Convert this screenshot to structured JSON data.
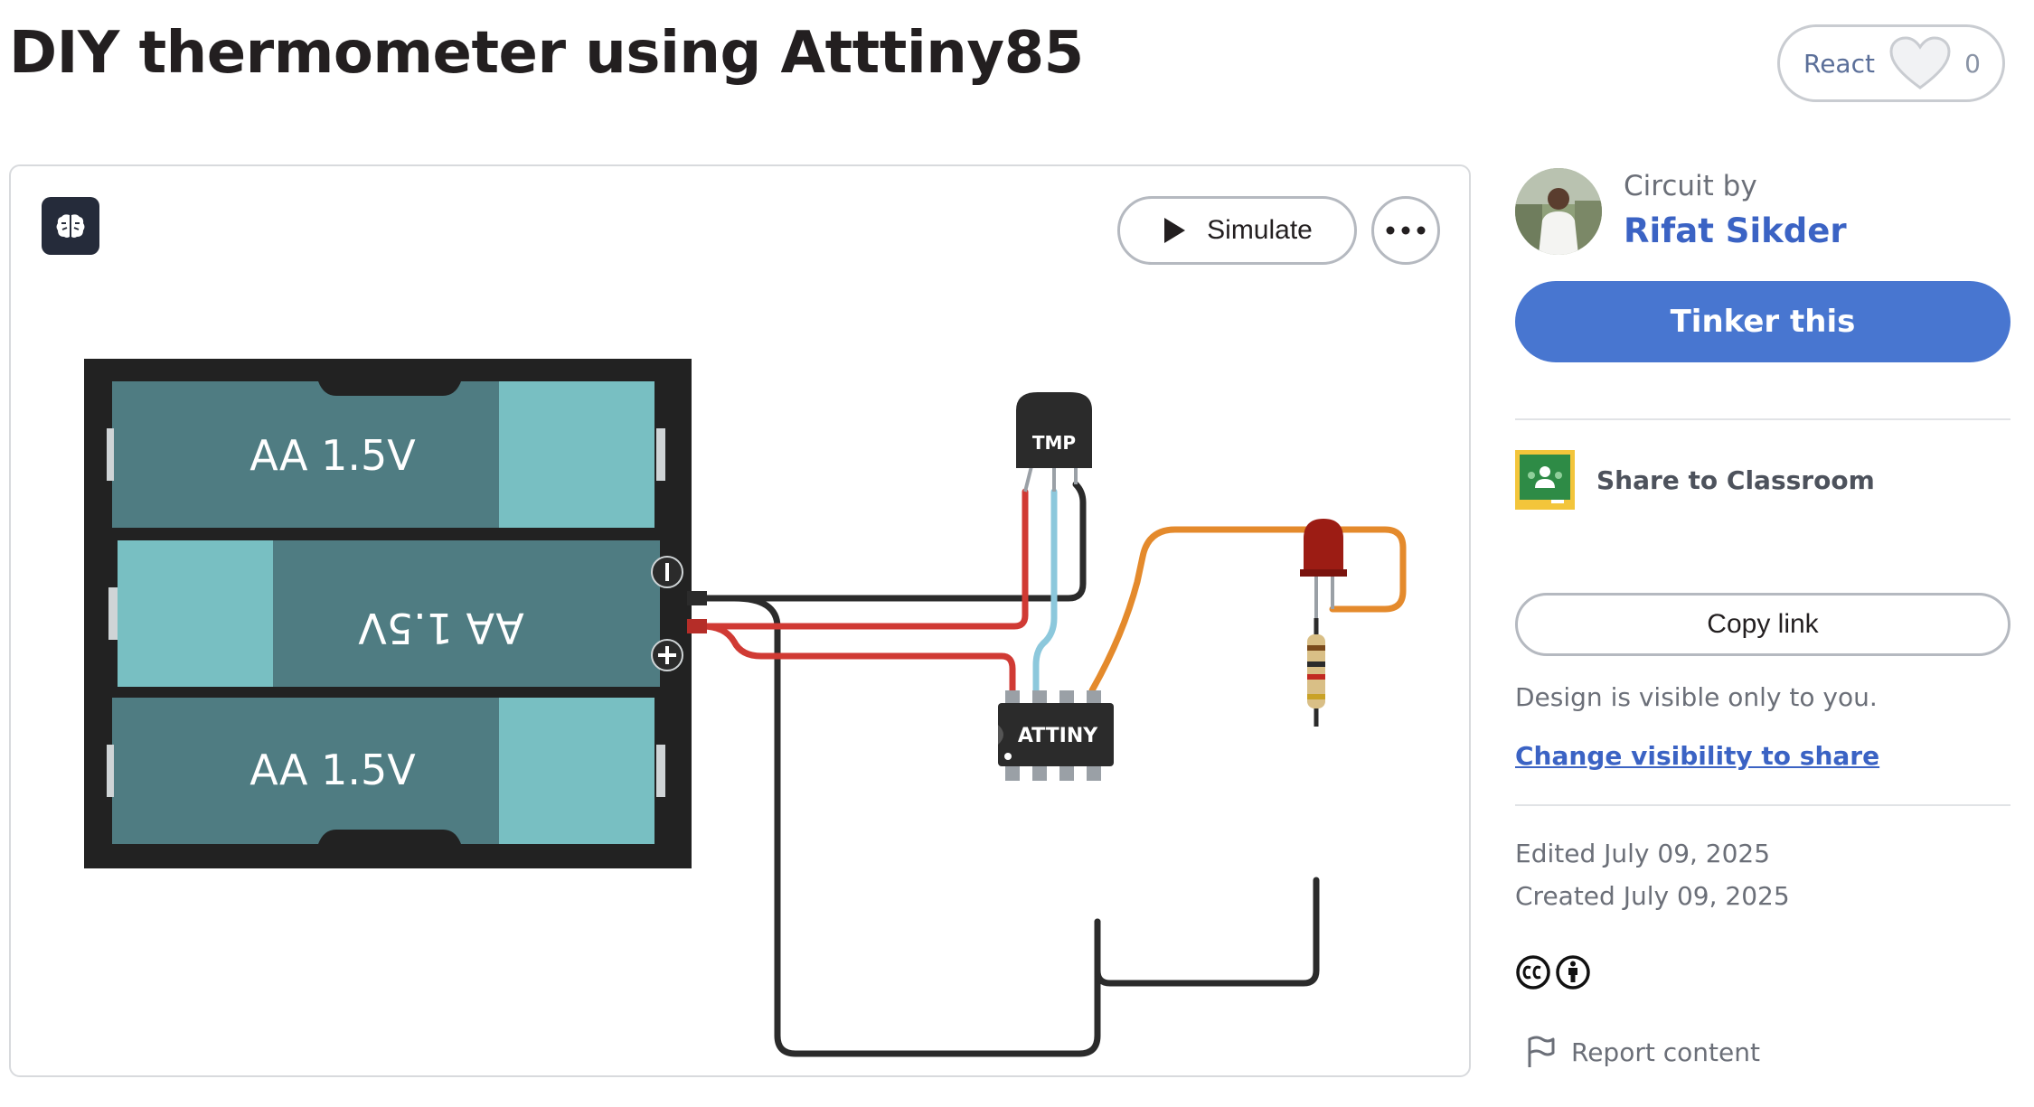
{
  "page": {
    "title": "DIY thermometer using Atttiny85"
  },
  "react": {
    "label": "React",
    "count": "0"
  },
  "toolbar": {
    "simulate_label": "Simulate"
  },
  "circuit": {
    "battery_labels": [
      "AA 1.5V",
      "AA 1.5V",
      "AA 1.5V"
    ],
    "sensor_label": "TMP",
    "chip_label": "ATTINY"
  },
  "sidebar": {
    "circuit_by": "Circuit by",
    "author": "Rifat Sikder",
    "tinker_label": "Tinker this",
    "share_classroom": "Share to Classroom",
    "copy_link": "Copy link",
    "visibility_note": "Design is visible only to you.",
    "change_visibility": "Change visibility to share",
    "edited": "Edited July 09, 2025",
    "created": "Created July 09, 2025",
    "report": "Report content"
  },
  "colors": {
    "primary": "#4876d0",
    "link": "#3b63c4",
    "battery_dark": "#4f7c82",
    "battery_light": "#78bfc2",
    "wire_red": "#d03a34",
    "wire_blue": "#8cc8dc",
    "wire_orange": "#e48a2c",
    "led_red": "#9c1c14"
  },
  "icons": {
    "brain": "brain-icon",
    "heart": "heart-icon",
    "play": "play-icon",
    "more": "more-horizontal-icon",
    "classroom": "google-classroom-icon",
    "cc": "creative-commons-icon",
    "attribution": "attribution-icon",
    "flag": "flag-icon"
  }
}
